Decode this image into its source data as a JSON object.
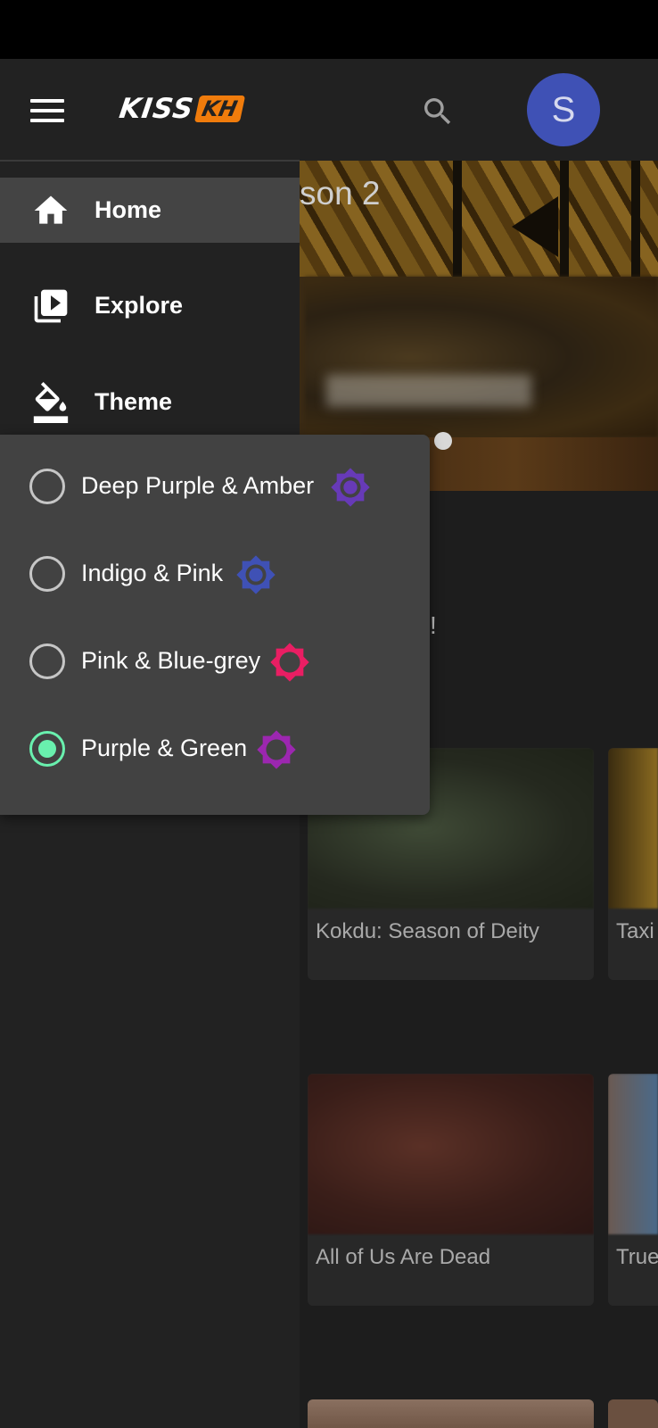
{
  "app": {
    "logo_text": "KISS",
    "logo_badge": "KH",
    "avatar_initial": "S"
  },
  "colors": {
    "accent_green": "#69f0ae",
    "avatar_bg": "#3f51b5",
    "logo_orange": "#f07c0c",
    "drawer_bg": "#222222",
    "popup_bg": "#424242"
  },
  "hero": {
    "title_fragment": "son 2"
  },
  "background": {
    "exclaim": "!"
  },
  "drawer": {
    "items": [
      {
        "label": "Home",
        "icon": "home-icon",
        "active": true
      },
      {
        "label": "Explore",
        "icon": "video-library-icon",
        "active": false
      },
      {
        "label": "Theme",
        "icon": "format-color-fill-icon",
        "active": false
      }
    ]
  },
  "theme_menu": {
    "options": [
      {
        "label": "Deep Purple & Amber",
        "swatch_color": "#673ab7",
        "selected": false
      },
      {
        "label": "Indigo & Pink",
        "swatch_color": "#3f51b5",
        "selected": false
      },
      {
        "label": "Pink & Blue-grey",
        "swatch_color": "#e91e63",
        "selected": false
      },
      {
        "label": "Purple & Green",
        "swatch_color": "#9c27b0",
        "selected": true
      }
    ]
  },
  "cards": [
    {
      "title": "Kokdu: Season of Deity"
    },
    {
      "title": "Taxi"
    },
    {
      "title": "All of Us Are Dead"
    },
    {
      "title": "True"
    }
  ]
}
